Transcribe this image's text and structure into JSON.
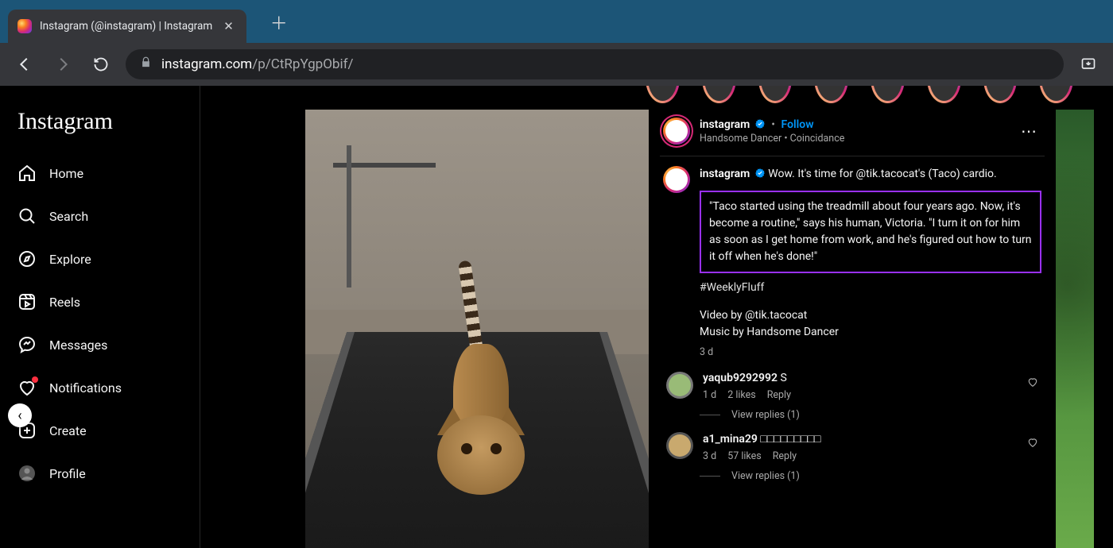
{
  "browser": {
    "tab_title": "Instagram (@instagram) | Instagram",
    "url_domain": "instagram.com",
    "url_path": "/p/CtRpYgpObif/"
  },
  "sidebar": {
    "logo": "Instagram",
    "items": [
      {
        "label": "Home"
      },
      {
        "label": "Search"
      },
      {
        "label": "Explore"
      },
      {
        "label": "Reels"
      },
      {
        "label": "Messages"
      },
      {
        "label": "Notifications"
      },
      {
        "label": "Create"
      },
      {
        "label": "Profile"
      }
    ]
  },
  "post": {
    "author": "instagram",
    "follow": "Follow",
    "music": "Handsome Dancer • Coincidance",
    "caption_lead": "Wow. It's time for @tik.tacocat's (Taco) cardio.",
    "caption_quote": "\"Taco started using the treadmill about four years ago. Now, it's become a routine,\" says his human, Victoria. \"I turn it on for him as soon as I get home from work, and he's figured out how to turn it off when he's done!\"",
    "hashtag": "#WeeklyFluff",
    "credit_video": "Video by @tik.tacocat",
    "credit_music": "Music by Handsome Dancer",
    "age": "3 d"
  },
  "comments": [
    {
      "user": "yaqub9292992",
      "text": "S",
      "age": "1 d",
      "likes": "2 likes",
      "reply": "Reply",
      "replies_label": "View replies (1)"
    },
    {
      "user": "a1_mina29",
      "text": "□□□□□□□□□",
      "age": "3 d",
      "likes": "57 likes",
      "reply": "Reply",
      "replies_label": "View replies (1)"
    }
  ]
}
